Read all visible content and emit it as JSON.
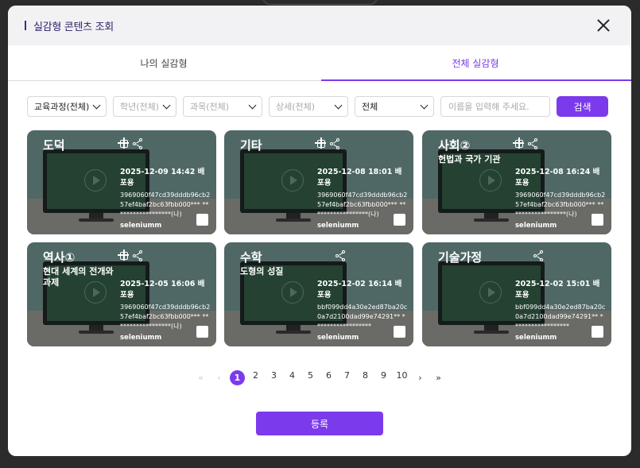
{
  "modal": {
    "title": "실감형 콘텐츠 조회",
    "tabs": [
      {
        "label": "나의 실감형",
        "active": false
      },
      {
        "label": "전체 실감형",
        "active": true
      }
    ]
  },
  "filters": {
    "curriculum": "교육과정(전체)",
    "grade": "학년(전체)",
    "subject": "과목(전체)",
    "detail": "상세(전체)",
    "scope": "전체",
    "search_placeholder": "이름을 입력해 주세요.",
    "search_button": "검색"
  },
  "cards": [
    {
      "subject": "도덕",
      "topic": "",
      "date": "2025-12-09 14:42 배포용",
      "hash": "3969060f47cd39dddb96cb257ef4baf2bc63fbb000*** ******************(나)",
      "author": "seleniumm",
      "icons": [
        "embed-icon",
        "share-icon"
      ]
    },
    {
      "subject": "기타",
      "topic": "",
      "date": "2025-12-08 18:01 배포용",
      "hash": "3969060f47cd39dddb96cb257ef4baf2bc63fbb000*** ******************(나)",
      "author": "seleniumm",
      "icons": [
        "embed-icon",
        "share-icon"
      ]
    },
    {
      "subject": "사회②",
      "topic": "헌법과 국가 기관",
      "date": "2025-12-08 16:24 배포용",
      "hash": "3969060f47cd39dddb96cb257ef4baf2bc63fbb000*** ******************(나)",
      "author": "seleniumm",
      "icons": [
        "embed-icon",
        "share-icon"
      ]
    },
    {
      "subject": "역사①",
      "topic": "현대 세계의 전개와 과제",
      "date": "2025-12-05 16:06 배포용",
      "hash": "3969060f47cd39dddb96cb257ef4baf2bc63fbb000*** ******************(나)",
      "author": "seleniumm",
      "icons": [
        "embed-icon",
        "share-icon"
      ]
    },
    {
      "subject": "수학",
      "topic": "도형의 성질",
      "date": "2025-12-02 16:14 배포용",
      "hash": "bbf099dd4a30e2ed87ba20c0a7d2100dad99e74291** ******************",
      "author": "seleniumm",
      "icons": [
        "share-icon"
      ]
    },
    {
      "subject": "기술가정",
      "topic": "",
      "date": "2025-12-02 15:01 배포용",
      "hash": "bbf099dd4a30e2ed87ba20c0a7d2100dad99e74291** ******************",
      "author": "seleniumm",
      "icons": [
        "share-icon"
      ]
    }
  ],
  "pager": {
    "first": "«",
    "prev": "‹",
    "pages": [
      "1",
      "2",
      "3",
      "4",
      "5",
      "6",
      "7",
      "8",
      "9",
      "10"
    ],
    "current": "1",
    "next": "›",
    "last": "»"
  },
  "register_button": "등록",
  "colors": {
    "accent": "#7c3aed",
    "title": "#2a2368"
  }
}
